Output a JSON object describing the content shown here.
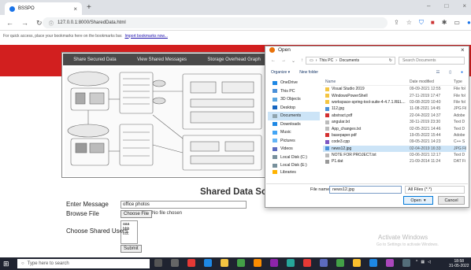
{
  "browser": {
    "tab_title": "BSSPO",
    "new_tab": "+",
    "url": "127.0.0.1:8000/SharedData.html",
    "bookmarks_hint": "For quick access, place your bookmarks here on the bookmarks bar.",
    "bookmarks_link": "Import bookmarks now..."
  },
  "app": {
    "menu": [
      "Share Secured Data",
      "View Shared Messages",
      "Storage Overhead Graph"
    ],
    "heading": "Shared Data Scr",
    "form": {
      "message_label": "Enter Message",
      "message_value": "office photos",
      "file_label": "Browse File",
      "file_button": "Choose File",
      "file_status": "No file chosen",
      "users_label": "Choose Shared Users",
      "users": [
        "aaa",
        "bbb",
        "ccc"
      ],
      "submit": "Submit"
    }
  },
  "dialog": {
    "title": "Open",
    "path": [
      "This PC",
      "Documents"
    ],
    "search_placeholder": "Search Documents",
    "organize": "Organize ▾",
    "new_folder": "New folder",
    "sidebar": [
      "OneDrive",
      "This PC",
      "3D Objects",
      "Desktop",
      "Documents",
      "Downloads",
      "Music",
      "Pictures",
      "Videos",
      "Local Disk (C:)",
      "Local Disk (E:)",
      "Libraries"
    ],
    "columns": [
      "Name",
      "Date modified",
      "Type"
    ],
    "files": [
      {
        "name": "Visual Studio 2019",
        "date": "09-09-2021 12:55",
        "type": "File fol"
      },
      {
        "name": "WindowsPowerShell",
        "date": "27-11-2019 17:47",
        "type": "File fol"
      },
      {
        "name": "workspace-spring-tool-suite-4-4.7.1.REL...",
        "date": "03-08-2020 10:40",
        "type": "File fol"
      },
      {
        "name": "112.jpg",
        "date": "11-08-2021 14:45",
        "type": "JPG Fil"
      },
      {
        "name": "abstract.pdf",
        "date": "22-04-2022 14:37",
        "type": "Adobe"
      },
      {
        "name": "angular.txt",
        "date": "30-11-2019 23:30",
        "type": "Text D"
      },
      {
        "name": "App_changes.txt",
        "date": "02-05-2021 14:46",
        "type": "Text D"
      },
      {
        "name": "basepaper.pdf",
        "date": "19-05-2022 15:44",
        "type": "Adobe"
      },
      {
        "name": "code3.cpp",
        "date": "09-05-2021 14:23",
        "type": "C++ S"
      },
      {
        "name": "news12.jpg",
        "date": "02-04-2019 16:33",
        "type": "JPG Fil"
      },
      {
        "name": "NOTE FOR PROJECT.txt",
        "date": "03-06-2021 12:17",
        "type": "Text D"
      },
      {
        "name": "P1.dat",
        "date": "21-09-2014 11:24",
        "type": "DAT Fi"
      }
    ],
    "file_name_label": "File name:",
    "file_name_value": "news12.jpg",
    "file_type": "All Files (*.*)",
    "open": "Open",
    "cancel": "Cancel"
  },
  "watermark": {
    "line1": "Activate Windows",
    "line2": "Go to Settings to activate Windows."
  },
  "taskbar": {
    "search_placeholder": "Type here to search",
    "time": "18:58",
    "date": "31-05-2022"
  },
  "colors": {
    "red_band": "#d21f1f",
    "menu_bar": "#4a4a4a",
    "taskbar": "#1f2330",
    "selection": "#cce4f7"
  }
}
